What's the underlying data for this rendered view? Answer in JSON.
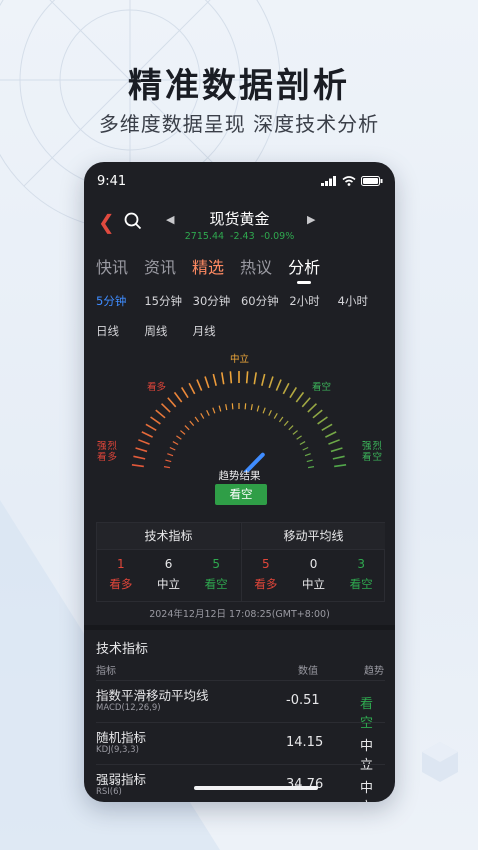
{
  "hero": {
    "title": "精准数据剖析",
    "subtitle": "多维度数据呈现  深度技术分析"
  },
  "status_bar": {
    "time": "9:41"
  },
  "nav": {
    "instrument": "现货黄金",
    "price": "2715.44",
    "change": "-2.43",
    "change_pct": "-0.09%"
  },
  "tabs": [
    {
      "label": "快讯"
    },
    {
      "label": "资讯"
    },
    {
      "label": "精选"
    },
    {
      "label": "热议"
    },
    {
      "label": "分析"
    }
  ],
  "periods": [
    {
      "label": "5分钟"
    },
    {
      "label": "15分钟"
    },
    {
      "label": "30分钟"
    },
    {
      "label": "60分钟"
    },
    {
      "label": "2小时"
    },
    {
      "label": "4小时"
    },
    {
      "label": "日线"
    },
    {
      "label": "周线"
    },
    {
      "label": "月线"
    }
  ],
  "selected_period": "5分钟",
  "gauge": {
    "labels": {
      "strong_buy": "强烈看多",
      "buy": "看多",
      "neutral": "中立",
      "sell": "看空",
      "strong_sell": "强烈看空"
    },
    "level": 0.72,
    "result_title": "趋势结果",
    "result": "看空"
  },
  "summary": {
    "technical": {
      "title": "技术指标",
      "counts": [
        {
          "value": "1",
          "label": "看多"
        },
        {
          "value": "6",
          "label": "中立"
        },
        {
          "value": "5",
          "label": "看空"
        }
      ]
    },
    "moving_avg": {
      "title": "移动平均线",
      "counts": [
        {
          "value": "5",
          "label": "看多"
        },
        {
          "value": "0",
          "label": "中立"
        },
        {
          "value": "3",
          "label": "看空"
        }
      ]
    },
    "timestamp": "2024年12月12日 17:08:25(GMT+8:00)"
  },
  "details": {
    "title": "技术指标",
    "headers": {
      "indicator": "指标",
      "value": "数值",
      "trend": "趋势"
    },
    "rows": [
      {
        "name": "指数平滑移动平均线",
        "code": "MACD(12,26,9)",
        "value": "-0.51",
        "trend": "看空"
      },
      {
        "name": "随机指标",
        "code": "KDJ(9,3,3)",
        "value": "14.15",
        "trend": "中立"
      },
      {
        "name": "强弱指标",
        "code": "RSI(6)",
        "value": "34.76",
        "trend": "中立"
      }
    ]
  },
  "colors": {
    "bearish": "#2fa84f",
    "bullish": "#e0463a",
    "neutral": "#f0a83a",
    "accent_blue": "#3f8cff",
    "hot_tab": "#ff8a62"
  }
}
